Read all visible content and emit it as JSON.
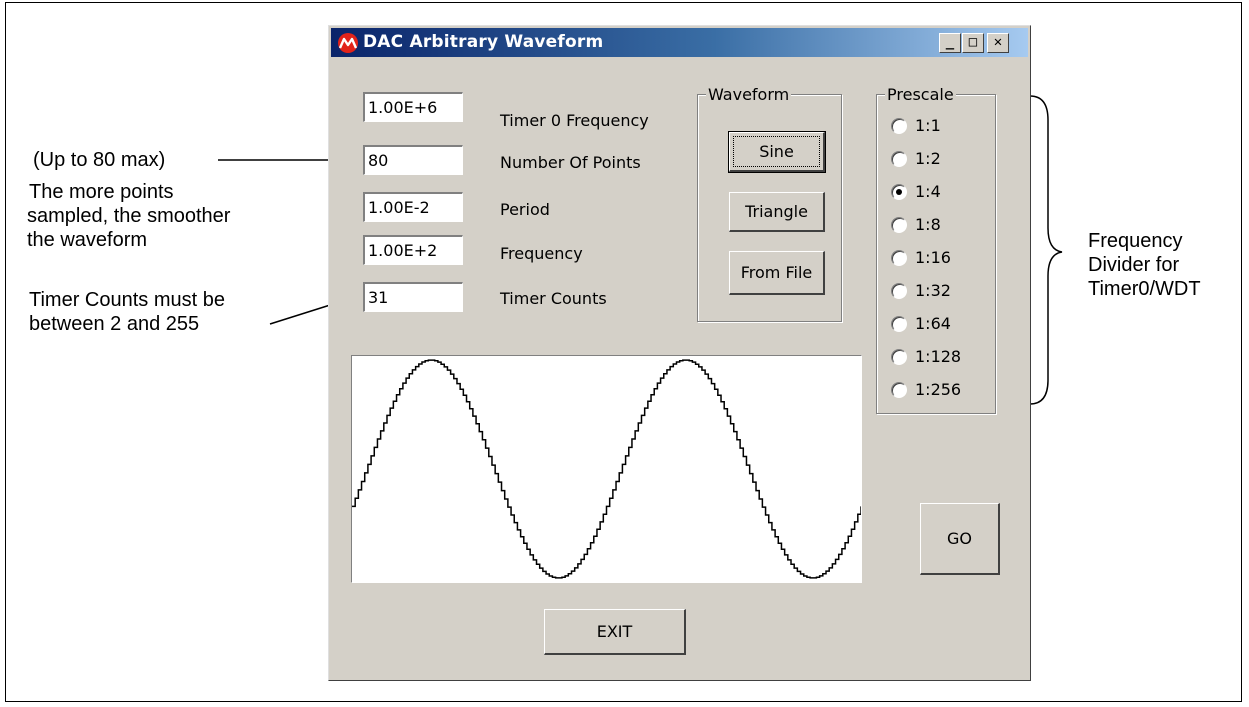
{
  "window": {
    "title": "DAC Arbitrary Waveform",
    "controls": {
      "minimize": "_",
      "maximize": "□",
      "close": "✕"
    }
  },
  "fields": [
    {
      "value": "1.00E+6",
      "label": "Timer 0 Frequency"
    },
    {
      "value": "80",
      "label": "Number Of Points"
    },
    {
      "value": "1.00E-2",
      "label": "Period"
    },
    {
      "value": "1.00E+2",
      "label": "Frequency"
    },
    {
      "value": "31",
      "label": "Timer Counts"
    }
  ],
  "waveform_group": {
    "title": "Waveform",
    "buttons": [
      "Sine",
      "Triangle",
      "From File"
    ]
  },
  "prescale_group": {
    "title": "Prescale",
    "options": [
      "1:1",
      "1:2",
      "1:4",
      "1:8",
      "1:16",
      "1:32",
      "1:64",
      "1:128",
      "1:256"
    ],
    "selected": "1:4"
  },
  "buttons": {
    "go": "GO",
    "exit": "EXIT"
  },
  "plot": {
    "waveform": "sine",
    "cycles": 2,
    "points_per_cycle": 80
  },
  "annotations": {
    "max_points": "(Up to 80 max)",
    "smooth_1": "The more points",
    "smooth_2": "sampled, the smoother",
    "smooth_3": "the waveform",
    "counts_1": "Timer Counts must be",
    "counts_2": "between 2 and 255",
    "divider_1": "Frequency",
    "divider_2": "Divider for",
    "divider_3": "Timer0/WDT"
  },
  "colors": {
    "dialog_bg": "#d4d0c8",
    "titlebar_start": "#0a246a",
    "titlebar_end": "#a6caf0",
    "logo_red": "#e2231a"
  }
}
